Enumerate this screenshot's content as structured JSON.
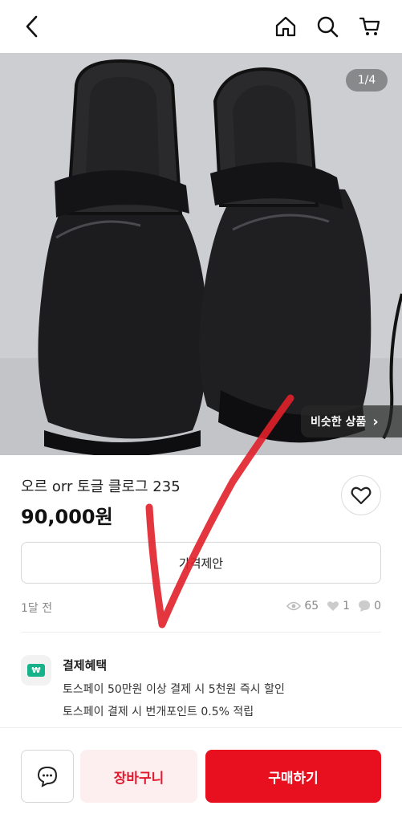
{
  "header": {
    "icons": [
      "back-icon",
      "home-icon",
      "search-icon",
      "cart-icon"
    ]
  },
  "gallery": {
    "counter": "1/4",
    "similar_label": "비슷한 상품",
    "similar_chevron": "›"
  },
  "product": {
    "title": "오르 orr 토글 클로그 235",
    "price": "90,000원"
  },
  "offer": {
    "label": "가격제안"
  },
  "meta": {
    "time": "1달 전",
    "views": "65",
    "likes": "1",
    "chats": "0"
  },
  "benefits": {
    "icon_text": "₩",
    "title": "결제혜택",
    "lines": [
      "토스페이 50만원 이상 결제 시 5천원 즉시 할인",
      "토스페이 결제 시 번개포인트 0.5% 적립"
    ]
  },
  "actions": {
    "cart_label": "장바구니",
    "buy_label": "구매하기"
  },
  "colors": {
    "accent": "#e8101f",
    "cart_bg": "#fdeef0",
    "annotation_check": "#e0202a"
  }
}
